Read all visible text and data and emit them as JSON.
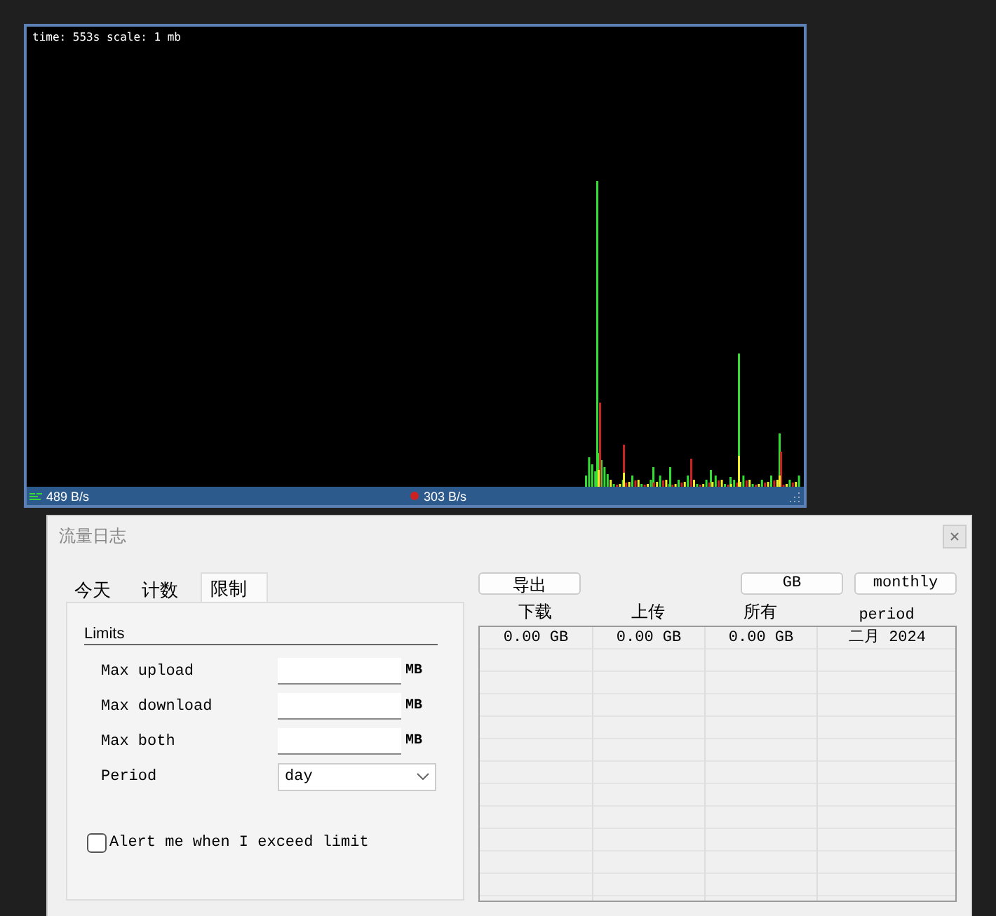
{
  "graph": {
    "caption": "time: 553s scale: 1 mb",
    "download_rate": "489 B/s",
    "upload_rate": "303 B/s"
  },
  "dialog": {
    "title": "流量日志",
    "tabs": [
      {
        "label": "今天",
        "selected": false
      },
      {
        "label": "计数",
        "selected": false
      },
      {
        "label": "限制",
        "selected": true
      }
    ],
    "limits": {
      "heading": "Limits",
      "fields": [
        {
          "label": "Max upload",
          "unit": "MB"
        },
        {
          "label": "Max download",
          "unit": "MB"
        },
        {
          "label": "Max both",
          "unit": "MB"
        }
      ],
      "period": {
        "label": "Period",
        "value": "day"
      },
      "alert": {
        "label": "Alert me when I exceed limit",
        "checked": false
      }
    },
    "buttons": {
      "export": "导出",
      "unit": "GB",
      "mode": "monthly"
    },
    "table": {
      "columns": [
        "下载",
        "上传",
        "所有",
        "period"
      ],
      "rows": [
        [
          "0.00 GB",
          "0.00 GB",
          "0.00 GB",
          "二月 2024"
        ]
      ]
    }
  }
}
